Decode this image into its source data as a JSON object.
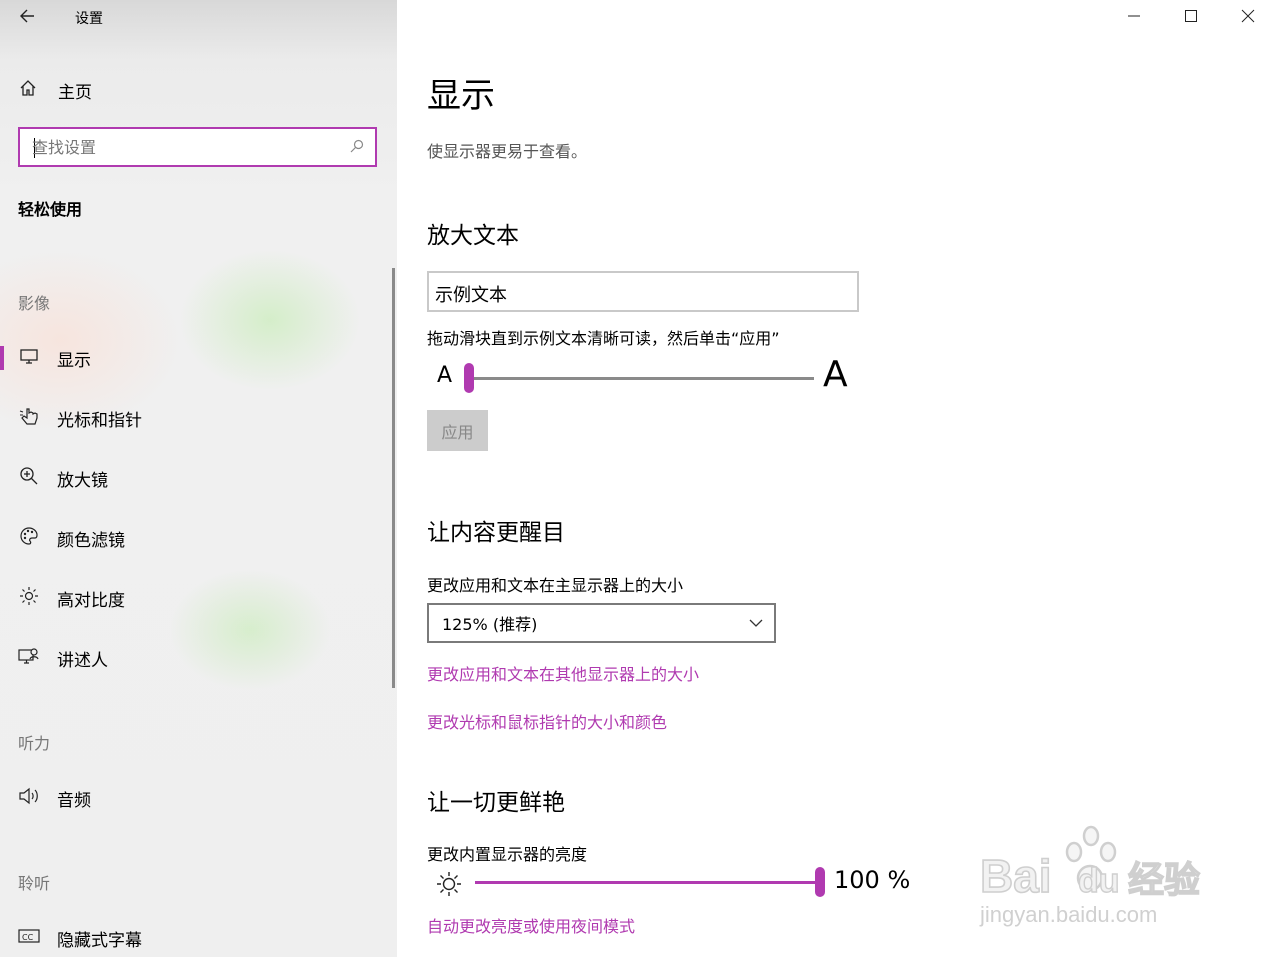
{
  "window": {
    "title": "设置",
    "minimize": "—",
    "maximize": "☐",
    "close": "✕"
  },
  "sidebar": {
    "home_label": "主页",
    "search_placeholder": "查找设置",
    "category_title": "轻松使用",
    "groups": [
      {
        "title": "影像",
        "items": [
          {
            "label": "显示",
            "icon": "monitor-icon",
            "selected": true
          },
          {
            "label": "光标和指针",
            "icon": "pointer-icon"
          },
          {
            "label": "放大镜",
            "icon": "magnifier-icon"
          },
          {
            "label": "颜色滤镜",
            "icon": "palette-icon"
          },
          {
            "label": "高对比度",
            "icon": "contrast-sun-icon"
          },
          {
            "label": "讲述人",
            "icon": "narrator-icon"
          }
        ]
      },
      {
        "title": "听力",
        "items": [
          {
            "label": "音频",
            "icon": "speaker-icon"
          }
        ]
      },
      {
        "title": "聆听",
        "items": [
          {
            "label": "隐藏式字幕",
            "icon": "cc-icon"
          }
        ]
      }
    ]
  },
  "main": {
    "title": "显示",
    "description": "使显示器更易于查看。",
    "enlarge_text": {
      "heading": "放大文本",
      "sample_text": "示例文本",
      "hint": "拖动滑块直到示例文本清晰可读，然后单击“应用”",
      "small_a": "A",
      "large_a": "A",
      "slider_value": 0,
      "apply_label": "应用"
    },
    "bigger": {
      "heading": "让内容更醒目",
      "scale_label": "更改应用和文本在主显示器上的大小",
      "scale_value": "125% (推荐)",
      "link_other_displays": "更改应用和文本在其他显示器上的大小",
      "link_cursor": "更改光标和鼠标指针的大小和颜色"
    },
    "brighter": {
      "heading": "让一切更鲜艳",
      "brightness_label": "更改内置显示器的亮度",
      "brightness_value": "100 %",
      "link_night": "自动更改亮度或使用夜间模式"
    }
  },
  "watermark": {
    "brand": "Bai",
    "brand2": "du",
    "cn": "经验",
    "url": "jingyan.baidu.com"
  },
  "colors": {
    "accent": "#b03ab0",
    "track": "#8a8a8a"
  }
}
